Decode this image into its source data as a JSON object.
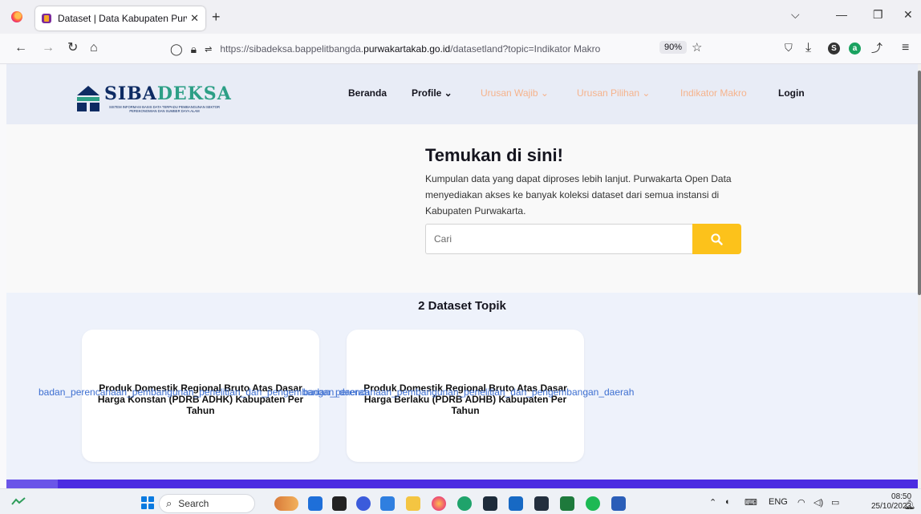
{
  "browser": {
    "tab_title": "Dataset | Data Kabupaten Purwa",
    "tab_close": "✕",
    "new_tab": "+",
    "url_prefix": "https://sibadeksa.bappelitbangda.",
    "url_domain": "purwakartakab.go.id",
    "url_path": "/datasetland?topic=Indikator Makro",
    "zoom": "90%",
    "window_controls": {
      "dropdown": "⌵",
      "minimize": "—",
      "restore": "❐",
      "close": "✕"
    },
    "icons": [
      "back-icon",
      "forward-icon",
      "reload-icon",
      "home-icon",
      "shield-icon",
      "lock-icon",
      "permissions-icon",
      "bookmark-star-icon",
      "pocket-icon",
      "download-icon",
      "menu-icon"
    ]
  },
  "site": {
    "logo": {
      "word_part1": "SIBA",
      "word_part2": "DEKSA",
      "subtitle": "SISTEM INFORMASI BASIS DATA TERPADU PEMBANGUNAN SEKTOR PEREKONOMIAN DAN SUMBER DAYA ALAM"
    },
    "nav": {
      "beranda": "Beranda",
      "profile": "Profile ⌄",
      "urusan_wajib": "Urusan Wajib ⌄",
      "urusan_pilihan": "Urusan Pilihan ⌄",
      "indikator_makro": "Indikator Makro",
      "login": "Login"
    },
    "hero": {
      "title": "Temukan di sini!",
      "description": "Kumpulan data yang dapat diproses lebih lanjut. Purwakarta Open Data menyediakan akses ke banyak koleksi dataset dari semua instansi di Kabupaten Purwakarta.",
      "search_placeholder": "Cari"
    },
    "datasets": {
      "heading": "2 Dataset Topik",
      "cards": [
        {
          "title": "Produk Domestik Regional Bruto Atas Dasar Harga Konstan (PDRB ADHK) Kabupaten Per Tahun",
          "org": "badan_perencanaan_pembangunan_penelitian_dan_pengembangan_daerah"
        },
        {
          "title": "Produk Domestik Regional Bruto Atas Dasar Harga Berlaku (PDRB ADHB) Kabupaten Per Tahun",
          "org": "badan_perencanaan_pembangunan_penelitian_dan_pengembangan_daerah"
        }
      ]
    }
  },
  "taskbar": {
    "search_label": "Search",
    "language": "ENG",
    "time": "08:50",
    "date": "25/10/2023"
  },
  "colors": {
    "accent_yellow": "#fcc21b",
    "brand_navy": "#0e2b63",
    "brand_teal": "#2d9f86",
    "footer": "#4b2ce1",
    "link": "#3d6fd1"
  }
}
